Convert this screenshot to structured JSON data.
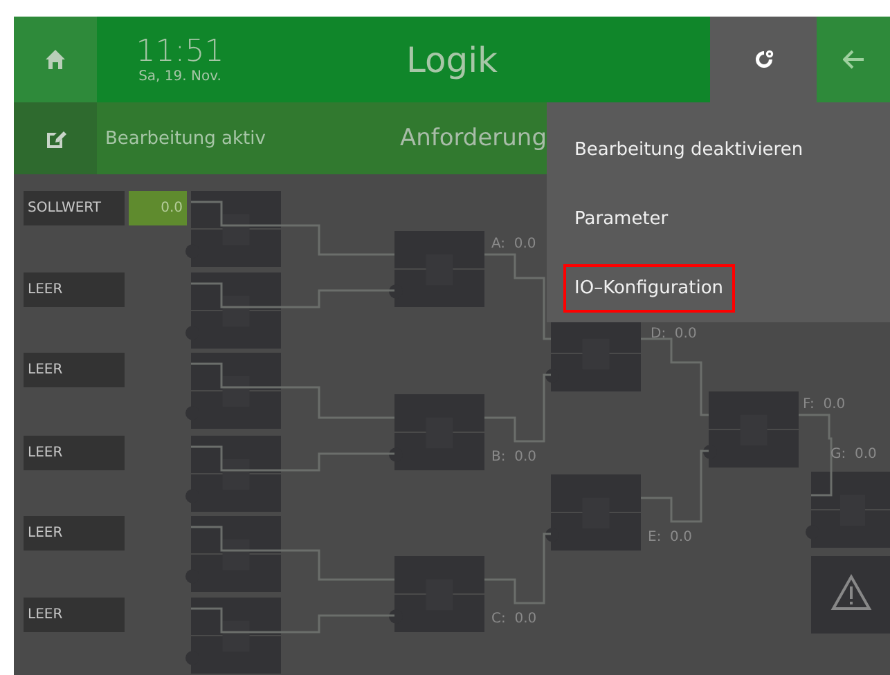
{
  "header": {
    "time": "11:51",
    "date": "Sa, 19. Nov.",
    "title": "Logik"
  },
  "edit_bar": {
    "status": "Bearbeitung aktiv",
    "title": "Anforderung"
  },
  "menu": {
    "items": [
      {
        "label": "Bearbeitung deaktivieren",
        "selected": false
      },
      {
        "label": "Parameter",
        "selected": false
      },
      {
        "label": "IO–Konfiguration",
        "selected": true
      }
    ]
  },
  "inputs": [
    {
      "label": "SOLLWERT",
      "value": "0.0"
    },
    {
      "label": "LEER"
    },
    {
      "label": "LEER"
    },
    {
      "label": "LEER"
    },
    {
      "label": "LEER"
    },
    {
      "label": "LEER"
    }
  ],
  "outputs": [
    {
      "name": "A:",
      "value": "0.0"
    },
    {
      "name": "B:",
      "value": "0.0"
    },
    {
      "name": "C:",
      "value": "0.0"
    },
    {
      "name": "D:",
      "value": "0.0"
    },
    {
      "name": "E:",
      "value": "0.0"
    },
    {
      "name": "F:",
      "value": "0.0"
    },
    {
      "name": "G:",
      "value": "0.0"
    }
  ]
}
